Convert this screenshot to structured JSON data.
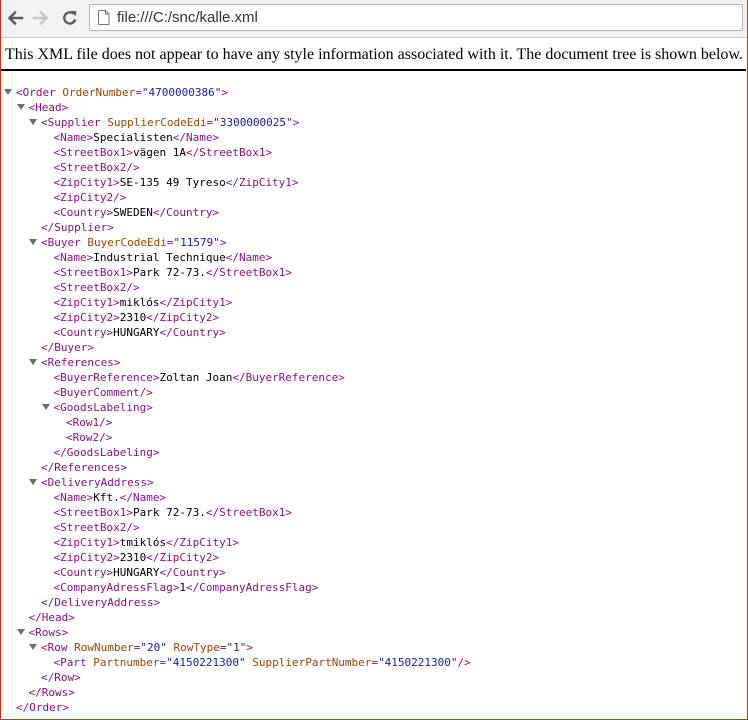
{
  "browser": {
    "url": "file:///C:/snc/kalle.xml"
  },
  "info_message": "This XML file does not appear to have any style information associated with it. The document tree is shown below.",
  "colors": {
    "tag": "#881280",
    "attribute_name": "#994500",
    "attribute_value": "#1a1aa6",
    "text": "#000000",
    "window_frame": "#e8241c"
  },
  "xml_lines": [
    {
      "depth": 0,
      "toggle": true,
      "parts": [
        [
          "t",
          "<Order"
        ],
        [
          "t",
          " "
        ],
        [
          "a",
          "OrderNumber"
        ],
        [
          "t",
          "="
        ],
        [
          "v",
          "\"4700000386\""
        ],
        [
          "t",
          ">"
        ]
      ]
    },
    {
      "depth": 1,
      "toggle": true,
      "parts": [
        [
          "t",
          "<Head>"
        ]
      ]
    },
    {
      "depth": 2,
      "toggle": true,
      "parts": [
        [
          "t",
          "<Supplier"
        ],
        [
          "t",
          " "
        ],
        [
          "a",
          "SupplierCodeEdi"
        ],
        [
          "t",
          "="
        ],
        [
          "v",
          "\"3300000025\""
        ],
        [
          "t",
          ">"
        ]
      ]
    },
    {
      "depth": 3,
      "toggle": false,
      "parts": [
        [
          "t",
          "<Name>"
        ],
        [
          "x",
          "Specialisten"
        ],
        [
          "t",
          "</Name>"
        ]
      ]
    },
    {
      "depth": 3,
      "toggle": false,
      "parts": [
        [
          "t",
          "<StreetBox1>"
        ],
        [
          "x",
          "vägen 1A"
        ],
        [
          "t",
          "</StreetBox1>"
        ]
      ]
    },
    {
      "depth": 3,
      "toggle": false,
      "parts": [
        [
          "t",
          "<StreetBox2/>"
        ]
      ]
    },
    {
      "depth": 3,
      "toggle": false,
      "parts": [
        [
          "t",
          "<ZipCity1>"
        ],
        [
          "x",
          "SE-135 49 Tyreso"
        ],
        [
          "t",
          "</ZipCity1>"
        ]
      ]
    },
    {
      "depth": 3,
      "toggle": false,
      "parts": [
        [
          "t",
          "<ZipCity2/>"
        ]
      ]
    },
    {
      "depth": 3,
      "toggle": false,
      "parts": [
        [
          "t",
          "<Country>"
        ],
        [
          "x",
          "SWEDEN"
        ],
        [
          "t",
          "</Country>"
        ]
      ]
    },
    {
      "depth": 2,
      "toggle": false,
      "parts": [
        [
          "t",
          "</Supplier>"
        ]
      ]
    },
    {
      "depth": 2,
      "toggle": true,
      "parts": [
        [
          "t",
          "<Buyer"
        ],
        [
          "t",
          " "
        ],
        [
          "a",
          "BuyerCodeEdi"
        ],
        [
          "t",
          "="
        ],
        [
          "v",
          "\"11579\""
        ],
        [
          "t",
          ">"
        ]
      ]
    },
    {
      "depth": 3,
      "toggle": false,
      "parts": [
        [
          "t",
          "<Name>"
        ],
        [
          "x",
          "Industrial Technique"
        ],
        [
          "t",
          "</Name>"
        ]
      ]
    },
    {
      "depth": 3,
      "toggle": false,
      "parts": [
        [
          "t",
          "<StreetBox1>"
        ],
        [
          "x",
          "Park 72-73."
        ],
        [
          "t",
          "</StreetBox1>"
        ]
      ]
    },
    {
      "depth": 3,
      "toggle": false,
      "parts": [
        [
          "t",
          "<StreetBox2/>"
        ]
      ]
    },
    {
      "depth": 3,
      "toggle": false,
      "parts": [
        [
          "t",
          "<ZipCity1>"
        ],
        [
          "x",
          "miklós"
        ],
        [
          "t",
          "</ZipCity1>"
        ]
      ]
    },
    {
      "depth": 3,
      "toggle": false,
      "parts": [
        [
          "t",
          "<ZipCity2>"
        ],
        [
          "x",
          "2310"
        ],
        [
          "t",
          "</ZipCity2>"
        ]
      ]
    },
    {
      "depth": 3,
      "toggle": false,
      "parts": [
        [
          "t",
          "<Country>"
        ],
        [
          "x",
          "HUNGARY"
        ],
        [
          "t",
          "</Country>"
        ]
      ]
    },
    {
      "depth": 2,
      "toggle": false,
      "parts": [
        [
          "t",
          "</Buyer>"
        ]
      ]
    },
    {
      "depth": 2,
      "toggle": true,
      "parts": [
        [
          "t",
          "<References>"
        ]
      ]
    },
    {
      "depth": 3,
      "toggle": false,
      "parts": [
        [
          "t",
          "<BuyerReference>"
        ],
        [
          "x",
          "Zoltan Joan"
        ],
        [
          "t",
          "</BuyerReference>"
        ]
      ]
    },
    {
      "depth": 3,
      "toggle": false,
      "parts": [
        [
          "t",
          "<BuyerComment/>"
        ]
      ]
    },
    {
      "depth": 3,
      "toggle": true,
      "parts": [
        [
          "t",
          "<GoodsLabeling>"
        ]
      ]
    },
    {
      "depth": 4,
      "toggle": false,
      "parts": [
        [
          "t",
          "<Row1/>"
        ]
      ]
    },
    {
      "depth": 4,
      "toggle": false,
      "parts": [
        [
          "t",
          "<Row2/>"
        ]
      ]
    },
    {
      "depth": 3,
      "toggle": false,
      "parts": [
        [
          "t",
          "</GoodsLabeling>"
        ]
      ]
    },
    {
      "depth": 2,
      "toggle": false,
      "parts": [
        [
          "t",
          "</References>"
        ]
      ]
    },
    {
      "depth": 2,
      "toggle": true,
      "parts": [
        [
          "t",
          "<DeliveryAddress>"
        ]
      ]
    },
    {
      "depth": 3,
      "toggle": false,
      "parts": [
        [
          "t",
          "<Name>"
        ],
        [
          "x",
          "Kft."
        ],
        [
          "t",
          "</Name>"
        ]
      ]
    },
    {
      "depth": 3,
      "toggle": false,
      "parts": [
        [
          "t",
          "<StreetBox1>"
        ],
        [
          "x",
          "Park 72-73."
        ],
        [
          "t",
          "</StreetBox1>"
        ]
      ]
    },
    {
      "depth": 3,
      "toggle": false,
      "parts": [
        [
          "t",
          "<StreetBox2/>"
        ]
      ]
    },
    {
      "depth": 3,
      "toggle": false,
      "parts": [
        [
          "t",
          "<ZipCity1>"
        ],
        [
          "x",
          "tmiklós"
        ],
        [
          "t",
          "</ZipCity1>"
        ]
      ]
    },
    {
      "depth": 3,
      "toggle": false,
      "parts": [
        [
          "t",
          "<ZipCity2>"
        ],
        [
          "x",
          "2310"
        ],
        [
          "t",
          "</ZipCity2>"
        ]
      ]
    },
    {
      "depth": 3,
      "toggle": false,
      "parts": [
        [
          "t",
          "<Country>"
        ],
        [
          "x",
          "HUNGARY"
        ],
        [
          "t",
          "</Country>"
        ]
      ]
    },
    {
      "depth": 3,
      "toggle": false,
      "parts": [
        [
          "t",
          "<CompanyAdressFlag>"
        ],
        [
          "x",
          "1"
        ],
        [
          "t",
          "</CompanyAdressFlag>"
        ]
      ]
    },
    {
      "depth": 2,
      "toggle": false,
      "parts": [
        [
          "t",
          "</DeliveryAddress>"
        ]
      ]
    },
    {
      "depth": 1,
      "toggle": false,
      "parts": [
        [
          "t",
          "</Head>"
        ]
      ]
    },
    {
      "depth": 1,
      "toggle": true,
      "parts": [
        [
          "t",
          "<Rows>"
        ]
      ]
    },
    {
      "depth": 2,
      "toggle": true,
      "parts": [
        [
          "t",
          "<Row"
        ],
        [
          "t",
          " "
        ],
        [
          "a",
          "RowNumber"
        ],
        [
          "t",
          "="
        ],
        [
          "v",
          "\"20\""
        ],
        [
          "t",
          " "
        ],
        [
          "a",
          "RowType"
        ],
        [
          "t",
          "="
        ],
        [
          "v",
          "\"1\""
        ],
        [
          "t",
          ">"
        ]
      ]
    },
    {
      "depth": 3,
      "toggle": false,
      "parts": [
        [
          "t",
          "<Part"
        ],
        [
          "t",
          " "
        ],
        [
          "a",
          "Partnumber"
        ],
        [
          "t",
          "="
        ],
        [
          "v",
          "\"4150221300\""
        ],
        [
          "t",
          " "
        ],
        [
          "a",
          "SupplierPartNumber"
        ],
        [
          "t",
          "="
        ],
        [
          "v",
          "\"4150221300\""
        ],
        [
          "t",
          "/>"
        ]
      ]
    },
    {
      "depth": 2,
      "toggle": false,
      "parts": [
        [
          "t",
          "</Row>"
        ]
      ]
    },
    {
      "depth": 1,
      "toggle": false,
      "parts": [
        [
          "t",
          "</Rows>"
        ]
      ]
    },
    {
      "depth": 0,
      "toggle": false,
      "parts": [
        [
          "t",
          "</Order>"
        ]
      ]
    }
  ]
}
